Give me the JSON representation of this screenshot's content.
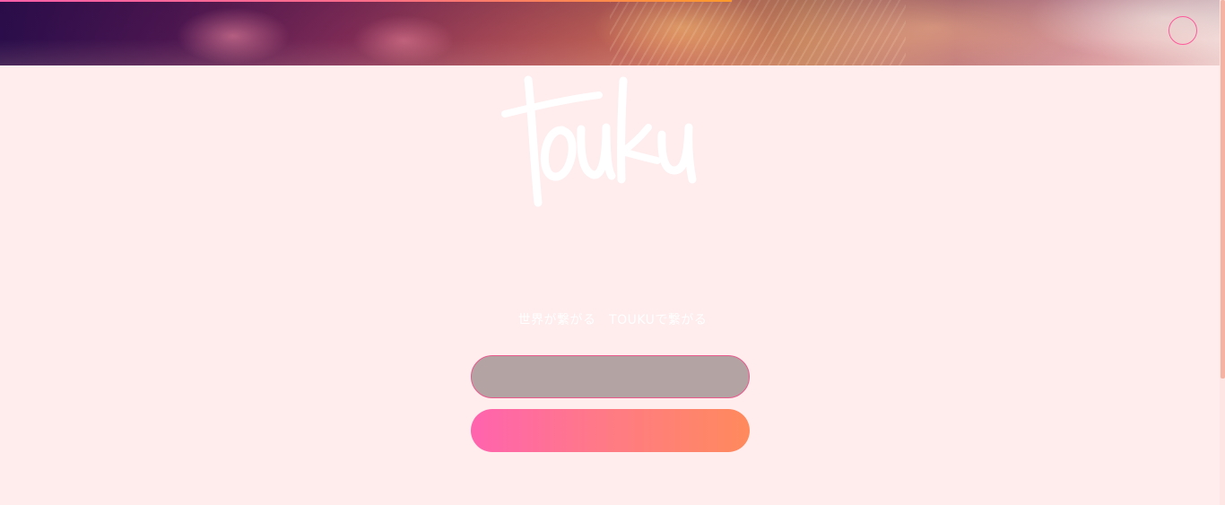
{
  "app": {
    "logo_text": "touku",
    "tagline": "世界が繋がる　TOUKUで繋がる"
  },
  "header": {
    "progress_fraction": 0.597
  },
  "actions": {
    "login_label": "",
    "signup_label": ""
  },
  "icons": {
    "menu": "menu-circle-icon",
    "logo": "touku-logo-icon"
  },
  "colors": {
    "background": "#ffeced",
    "accent_pink": "#ff5a9c",
    "accent_orange": "#ff8a5c",
    "login_button": "#b3a3a3"
  }
}
